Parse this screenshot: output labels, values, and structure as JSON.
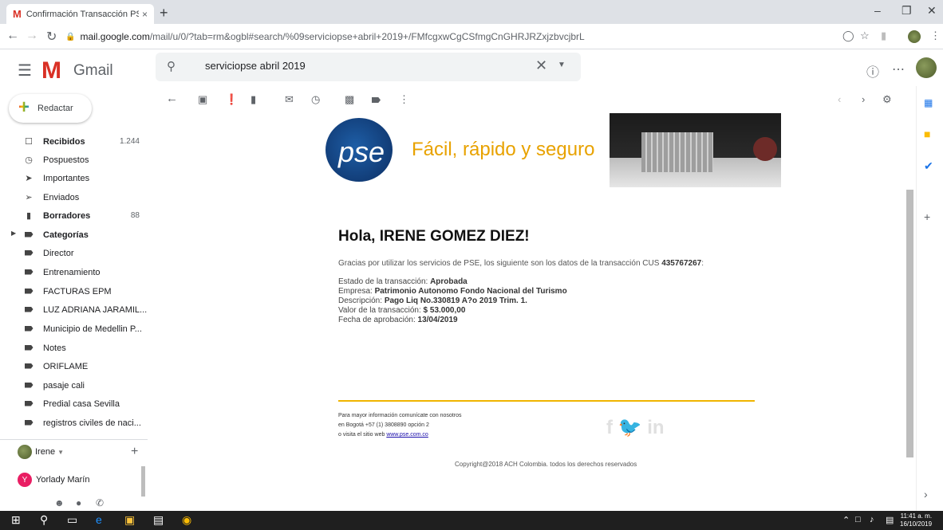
{
  "browser": {
    "tab_title": "Confirmación Transacción PSE - ",
    "tab_close": "×",
    "new_tab": "+",
    "url_host": "mail.google.com",
    "url_path": "/mail/u/0/?tab=rm&ogbl#search/%09serviciopse+abril+2019+/FMfcgxwCgCSfmgCnGHRJRZxjzbvcjbrL"
  },
  "gmail": {
    "logo_text": "Gmail",
    "search_value": "serviciopse abril 2019",
    "compose_label": "Redactar"
  },
  "sidebar": {
    "items": [
      {
        "label": "Recibidos",
        "count": "1.244",
        "icon": "inbox-icon"
      },
      {
        "label": "Pospuestos",
        "count": "",
        "icon": "clock-icon"
      },
      {
        "label": "Importantes",
        "count": "",
        "icon": "important-icon"
      },
      {
        "label": "Enviados",
        "count": "",
        "icon": "send-icon"
      },
      {
        "label": "Borradores",
        "count": "88",
        "icon": "draft-icon"
      },
      {
        "label": "Categorías",
        "count": "",
        "icon": "label-icon"
      },
      {
        "label": "Director",
        "count": "",
        "icon": "label-icon"
      },
      {
        "label": "Entrenamiento",
        "count": "",
        "icon": "label-icon"
      },
      {
        "label": "FACTURAS EPM",
        "count": "",
        "icon": "label-icon"
      },
      {
        "label": "LUZ ADRIANA JARAMIL...",
        "count": "",
        "icon": "label-icon"
      },
      {
        "label": "Municipio de Medellin P...",
        "count": "",
        "icon": "label-icon"
      },
      {
        "label": "Notes",
        "count": "",
        "icon": "label-icon"
      },
      {
        "label": "ORIFLAME",
        "count": "",
        "icon": "label-icon"
      },
      {
        "label": "pasaje cali",
        "count": "",
        "icon": "label-icon"
      },
      {
        "label": "Predial casa Sevilla",
        "count": "",
        "icon": "label-icon"
      },
      {
        "label": "registros civiles de naci...",
        "count": "",
        "icon": "label-icon"
      }
    ]
  },
  "hangouts": {
    "me": "Irene",
    "contact_initial": "Y",
    "contact_name": "Yorlady Marín"
  },
  "email": {
    "pse_logo": "pse",
    "tagline": "Fácil, rápido y seguro",
    "greeting": "Hola, IRENE GOMEZ DIEZ!",
    "intro": "Gracias por utilizar los servicios de PSE, los siguiente son los datos de la transacción CUS ",
    "cus": "435767267",
    "intro_end": ":",
    "details": {
      "estado_label": "Estado de la transacción: ",
      "estado_value": "Aprobada",
      "empresa_label": "Empresa: ",
      "empresa_value": "Patrimonio Autonomo Fondo Nacional del Turismo",
      "descripcion_label": "Descripción: ",
      "descripcion_value": "Pago Liq No.330819 A?o 2019 Trim. 1.",
      "valor_label": "Valor de la transacción: ",
      "valor_value": "$ 53.000,00",
      "fecha_label": "Fecha de aprobación: ",
      "fecha_value": "13/04/2019"
    },
    "footer": {
      "line1": "Para mayor información comunícate con nosotros",
      "line2": "en Bogotá +57 (1) 3808890 opción 2",
      "line3_pre": "o visita el sitio web ",
      "line3_link": "www.pse.com.co",
      "social": "f  🐦  in",
      "copyright": "Copyright@2018 ACH Colombia. todos los derechos reservados"
    }
  },
  "taskbar": {
    "time": "11:41 a. m.",
    "date": "16/10/2019"
  },
  "colors": {
    "gmail_red": "#d93025",
    "pse_orange": "#e8a200",
    "pse_blue": "#1e5ea6"
  }
}
